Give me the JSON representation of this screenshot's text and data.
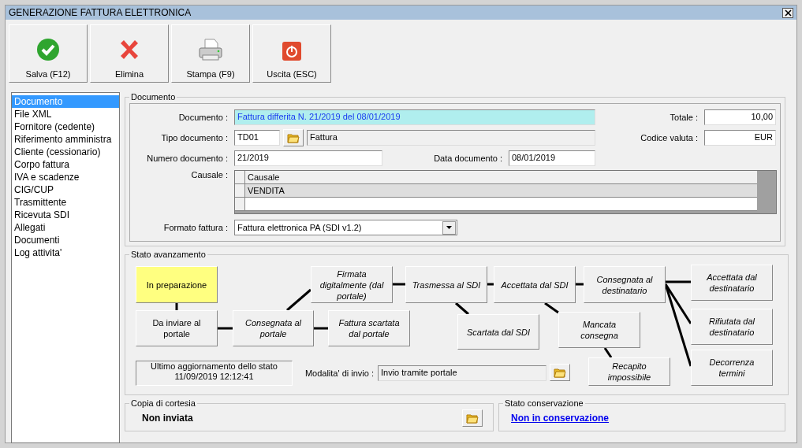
{
  "window": {
    "title": "GENERAZIONE FATTURA ELETTRONICA"
  },
  "toolbar": [
    {
      "label": "Salva (F12)",
      "kind": "save"
    },
    {
      "label": "Elimina",
      "kind": "delete"
    },
    {
      "label": "Stampa (F9)",
      "kind": "print"
    },
    {
      "label": "Uscita (ESC)",
      "kind": "exit"
    }
  ],
  "sidebar": {
    "items": [
      {
        "label": "Documento",
        "selected": true
      },
      {
        "label": "File XML",
        "selected": false
      },
      {
        "label": "Fornitore (cedente)",
        "selected": false
      },
      {
        "label": "Riferimento amministra",
        "selected": false
      },
      {
        "label": "Cliente (cessionario)",
        "selected": false
      },
      {
        "label": "Corpo fattura",
        "selected": false
      },
      {
        "label": "IVA e scadenze",
        "selected": false
      },
      {
        "label": "CIG/CUP",
        "selected": false
      },
      {
        "label": "Trasmittente",
        "selected": false
      },
      {
        "label": "Ricevuta SDI",
        "selected": false
      },
      {
        "label": "Allegati",
        "selected": false
      },
      {
        "label": "Documenti",
        "selected": false
      },
      {
        "label": "Log attivita'",
        "selected": false
      }
    ]
  },
  "documento": {
    "title": "Documento",
    "documento": {
      "label": "Documento :",
      "value": "Fattura differita N. 21/2019 del 08/01/2019"
    },
    "tipo_documento": {
      "label": "Tipo documento :",
      "code": "TD01",
      "description": "Fattura"
    },
    "numero_documento": {
      "label": "Numero documento :",
      "value": "21/2019"
    },
    "data_documento": {
      "label": "Data documento :",
      "value": "08/01/2019"
    },
    "totale": {
      "label": "Totale :",
      "value": "10,00"
    },
    "codice_valuta": {
      "label": "Codice valuta :",
      "value": "EUR"
    },
    "causale": {
      "label": "Causale :",
      "column": "Causale",
      "rows": [
        "VENDITA"
      ]
    },
    "formato_fattura": {
      "label": "Formato fattura :",
      "value": "Fattura elettronica PA (SDI v1.2)"
    }
  },
  "stato_avanzamento": {
    "title": "Stato avanzamento",
    "nodes": [
      {
        "label": "In preparazione",
        "selected": true,
        "reached": true
      },
      {
        "label": "Da inviare al portale",
        "selected": false,
        "reached": true
      },
      {
        "label": "Consegnata al portale",
        "selected": false,
        "reached": false
      },
      {
        "label": "Firmata digitalmente (dal portale)",
        "selected": false,
        "reached": false
      },
      {
        "label": "Fattura scartata dal portale",
        "selected": false,
        "reached": false
      },
      {
        "label": "Trasmessa al SDI",
        "selected": false,
        "reached": false
      },
      {
        "label": "Scartata dal SDI",
        "selected": false,
        "reached": false
      },
      {
        "label": "Accettata dal SDI",
        "selected": false,
        "reached": false
      },
      {
        "label": "Consegnata al destinatario",
        "selected": false,
        "reached": false
      },
      {
        "label": "Mancata consegna",
        "selected": false,
        "reached": false
      },
      {
        "label": "Recapito impossibile",
        "selected": false,
        "reached": false
      },
      {
        "label": "Accettata dal destinatario",
        "selected": false,
        "reached": false
      },
      {
        "label": "Rifiutata dal destinatario",
        "selected": false,
        "reached": false
      },
      {
        "label": "Decorrenza termini",
        "selected": false,
        "reached": false
      }
    ],
    "last_update": {
      "title": "Ultimo aggiornamento dello stato",
      "value": "11/09/2019 12:12:41"
    },
    "modalita_invio": {
      "label": "Modalita' di invio :",
      "value": "Invio tramite portale"
    }
  },
  "copia_cortesia": {
    "title": "Copia di cortesia",
    "value": "Non inviata"
  },
  "stato_conservazione": {
    "title": "Stato conservazione",
    "link": "Non in conservazione"
  }
}
